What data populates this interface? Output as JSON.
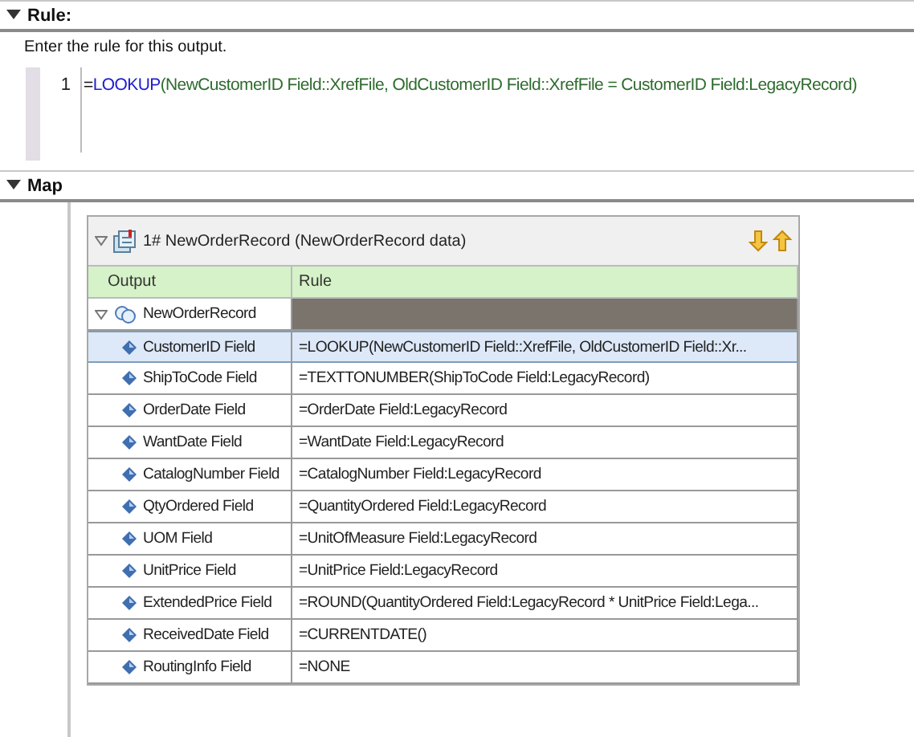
{
  "rule_section": {
    "title": "Rule:",
    "expanded": true,
    "description": "Enter the rule for this output.",
    "editor": {
      "line_number": "1",
      "tokens": [
        {
          "text": "=",
          "kind": "operator"
        },
        {
          "text": "LOOKUP",
          "kind": "function"
        },
        {
          "text": "(NewCustomerID Field::XrefFile, OldCustomerID Field::XrefFile = CustomerID Field:LegacyRecord)",
          "kind": "argument"
        }
      ]
    }
  },
  "map_section": {
    "title": "Map",
    "expanded": true,
    "panel": {
      "title": "1# NewOrderRecord (NewOrderRecord data)",
      "expanded": true,
      "columns": [
        "Output",
        "Rule"
      ],
      "root": {
        "name": "NewOrderRecord",
        "expanded": true,
        "children": [
          {
            "name": "CustomerID Field",
            "rule": "=LOOKUP(NewCustomerID Field::XrefFile, OldCustomerID Field::Xr...",
            "selected": true
          },
          {
            "name": "ShipToCode Field",
            "rule": "=TEXTTONUMBER(ShipToCode Field:LegacyRecord)",
            "selected": false
          },
          {
            "name": "OrderDate Field",
            "rule": "=OrderDate Field:LegacyRecord",
            "selected": false
          },
          {
            "name": "WantDate Field",
            "rule": "=WantDate Field:LegacyRecord",
            "selected": false
          },
          {
            "name": "CatalogNumber Field",
            "rule": "=CatalogNumber Field:LegacyRecord",
            "selected": false
          },
          {
            "name": "QtyOrdered Field",
            "rule": "=QuantityOrdered Field:LegacyRecord",
            "selected": false
          },
          {
            "name": "UOM Field",
            "rule": "=UnitOfMeasure Field:LegacyRecord",
            "selected": false
          },
          {
            "name": "UnitPrice Field",
            "rule": "=UnitPrice Field:LegacyRecord",
            "selected": false
          },
          {
            "name": "ExtendedPrice Field",
            "rule": "=ROUND(QuantityOrdered Field:LegacyRecord * UnitPrice Field:Lega...",
            "selected": false
          },
          {
            "name": "ReceivedDate Field",
            "rule": "=CURRENTDATE()",
            "selected": false
          },
          {
            "name": "RoutingInfo Field",
            "rule": "=NONE",
            "selected": false
          }
        ]
      }
    }
  }
}
